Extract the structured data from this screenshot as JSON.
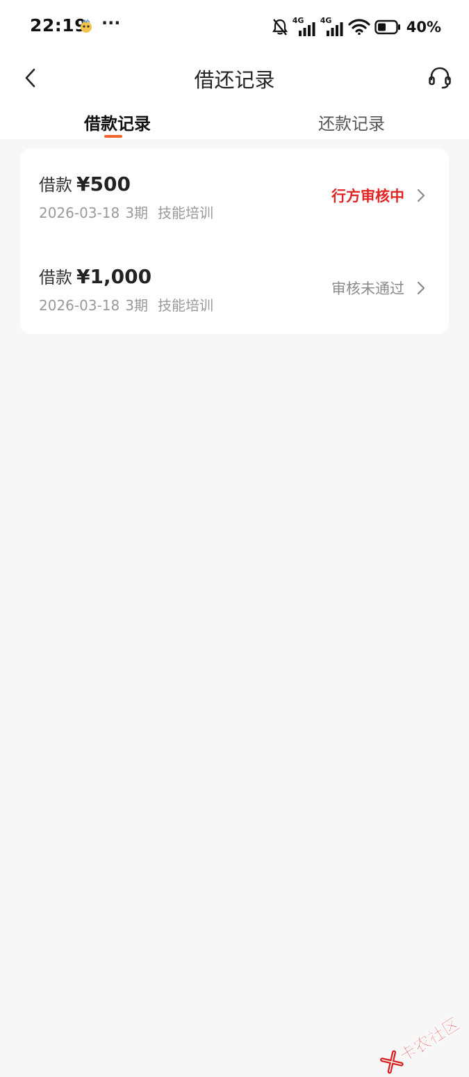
{
  "status_bar": {
    "time": "22:19",
    "more": "···",
    "network_1": "4G",
    "network_2": "4G",
    "battery": "40%"
  },
  "nav": {
    "title": "借还记录",
    "back_icon": "chevron-left-icon",
    "service_icon": "headset-icon"
  },
  "tabs": [
    {
      "label": "借款记录",
      "active": true
    },
    {
      "label": "还款记录",
      "active": false
    }
  ],
  "records": [
    {
      "kind": "借款",
      "amount": "¥500",
      "date": "2026-03-18",
      "term": "3期",
      "purpose": "技能培训",
      "status": "行方审核中",
      "status_color": "#e02424"
    },
    {
      "kind": "借款",
      "amount": "¥1,000",
      "date": "2026-03-18",
      "term": "3期",
      "purpose": "技能培训",
      "status": "审核未通过",
      "status_color": "#8a8a8a"
    }
  ],
  "colors": {
    "accent": "#f0662a",
    "background": "#f7f7f8",
    "card": "#ffffff"
  },
  "watermark": {
    "text": "卡农社区"
  }
}
